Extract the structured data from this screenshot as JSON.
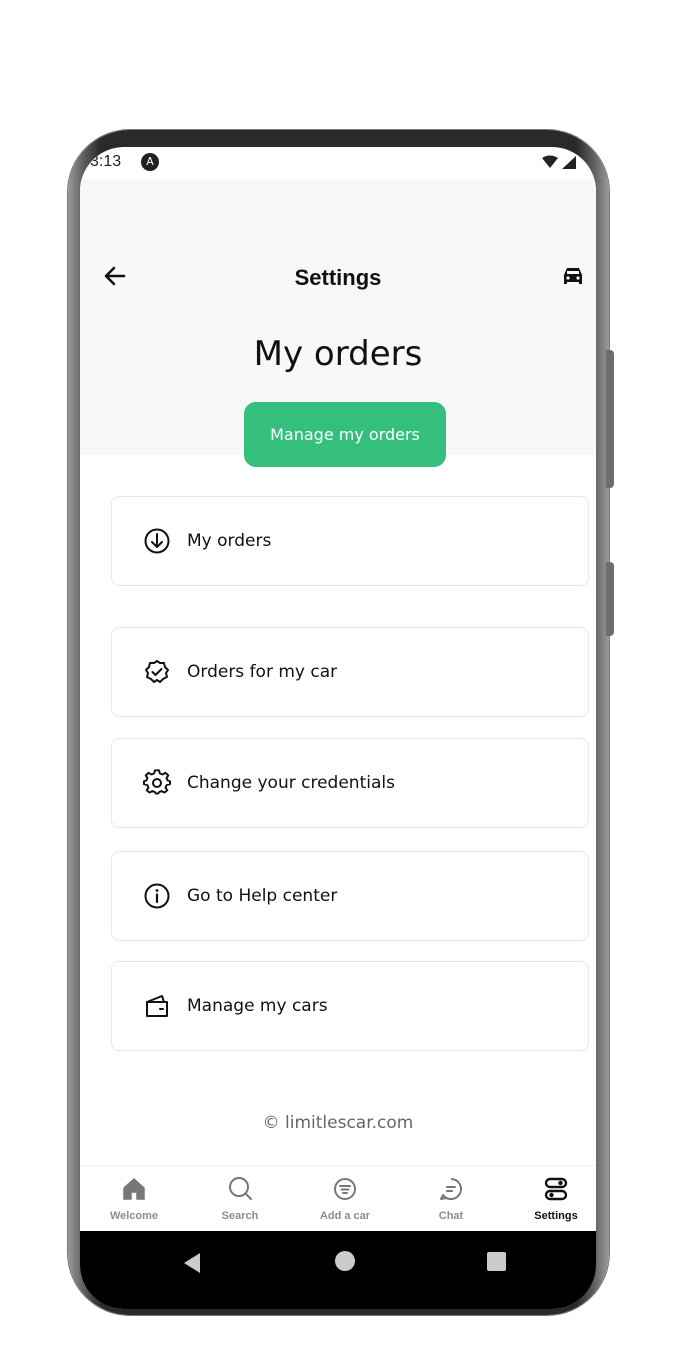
{
  "status_bar": {
    "time": "3:13",
    "notification_glyph": "A"
  },
  "header": {
    "title": "Settings",
    "back_icon": "arrow-left-icon",
    "right_icon": "car-icon"
  },
  "hero": {
    "heading": "My orders",
    "cta_label": "Manage my orders",
    "cta_color": "#34bf7c"
  },
  "menu": {
    "items": [
      {
        "label": "My orders",
        "icon": "download-circle-icon"
      },
      {
        "label": "Orders for my car",
        "icon": "badge-check-icon"
      },
      {
        "label": "Change your credentials",
        "icon": "gear-icon"
      },
      {
        "label": "Go to Help center",
        "icon": "info-icon"
      },
      {
        "label": "Manage my cars",
        "icon": "wallet-icon"
      }
    ]
  },
  "footer": {
    "copyright": "© limitlescar.com"
  },
  "bottom_nav": {
    "items": [
      {
        "label": "Welcome",
        "icon": "home-icon"
      },
      {
        "label": "Search",
        "icon": "search-icon"
      },
      {
        "label": "Add a car",
        "icon": "filter-circle-icon"
      },
      {
        "label": "Chat",
        "icon": "chat-icon"
      },
      {
        "label": "Settings",
        "icon": "settings-toggles-icon",
        "active": true
      }
    ]
  }
}
